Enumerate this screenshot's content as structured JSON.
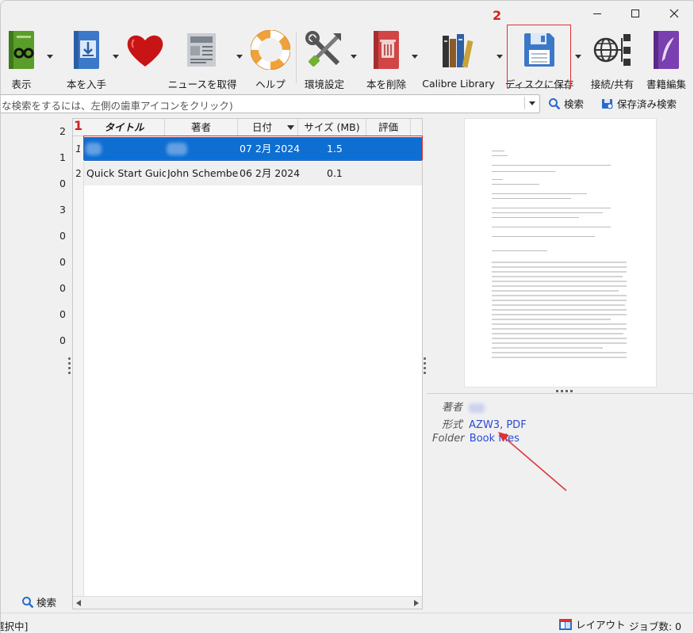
{
  "toolbar": {
    "items": [
      {
        "label": "表示"
      },
      {
        "label": "本を入手"
      },
      {
        "label": ""
      },
      {
        "label": "ニュースを取得"
      },
      {
        "label": "ヘルプ"
      },
      {
        "label": "環境設定"
      },
      {
        "label": "本を削除"
      },
      {
        "label": "Calibre Library"
      },
      {
        "label": "ディスクに保存"
      },
      {
        "label": "接続/共有"
      },
      {
        "label": "書籍編集"
      }
    ],
    "marker_2": "2"
  },
  "search": {
    "placeholder": "な検索をするには、左側の歯車アイコンをクリック)",
    "search_button": "検索",
    "saved_search_button": "保存済み検索"
  },
  "tag_browser": {
    "counts": [
      "2",
      "1",
      "0",
      "3",
      "0",
      "0",
      "0",
      "0",
      "0"
    ],
    "search_label": "検索"
  },
  "table": {
    "marker_1": "1",
    "columns": [
      "タイトル",
      "著者",
      "日付",
      "サイズ (MB)",
      "評価"
    ],
    "rows": [
      {
        "num": "1",
        "title": "",
        "author": "",
        "date": "07 2月 2024",
        "size": "1.5",
        "rating": ""
      },
      {
        "num": "2",
        "title": "Quick Start Guide",
        "author": "John Schember",
        "date": "06 2月 2024",
        "size": "0.1",
        "rating": ""
      }
    ]
  },
  "details": {
    "author_key": "著者",
    "author_value": "",
    "format_key": "形式",
    "format_value": "AZW3, PDF",
    "folder_key": "Folder",
    "folder_value": "Book files"
  },
  "status": {
    "left": "選択中]",
    "layout": "レイアウト",
    "jobs": "ジョブ数: 0"
  },
  "colors": {
    "selection": "#0e6ed2",
    "highlight": "#e03030",
    "link": "#2a4bd7"
  }
}
